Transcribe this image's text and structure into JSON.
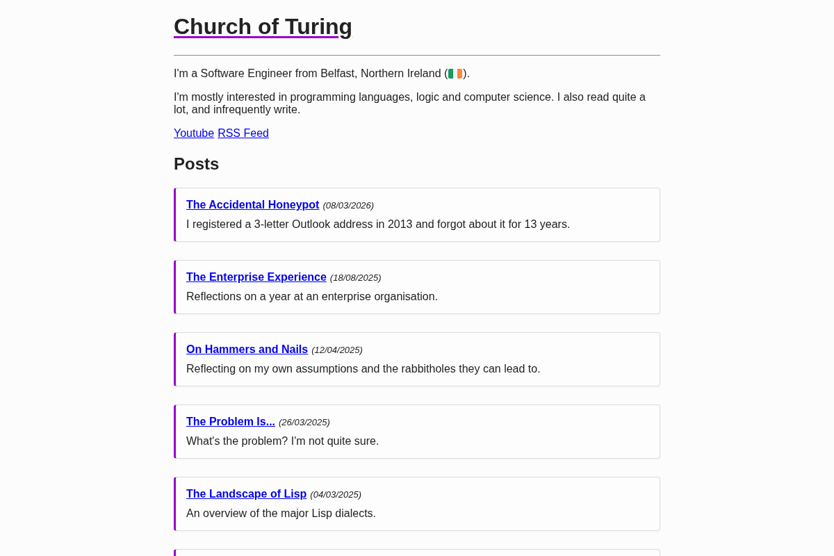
{
  "site_title": "Church of Turing",
  "intro": {
    "text_before_flag": "I'm a Software Engineer from Belfast, Northern Ireland (",
    "text_after_flag": ")."
  },
  "about": "I'm mostly interested in programming languages, logic and computer science. I also read quite a lot, and infrequently write.",
  "links": [
    "Youtube",
    "RSS Feed"
  ],
  "posts_heading": "Posts",
  "posts": [
    {
      "title": "The Accidental Honeypot",
      "date": "(08/03/2026)",
      "summary": "I registered a 3-letter Outlook address in 2013 and forgot about it for 13 years."
    },
    {
      "title": "The Enterprise Experience",
      "date": "(18/08/2025)",
      "summary": "Reflections on a year at an enterprise organisation."
    },
    {
      "title": "On Hammers and Nails",
      "date": "(12/04/2025)",
      "summary": "Reflecting on my own assumptions and the rabbitholes they can lead to."
    },
    {
      "title": "The Problem Is...",
      "date": "(26/03/2025)",
      "summary": "What's the problem? I'm not quite sure."
    },
    {
      "title": "The Landscape of Lisp",
      "date": "(04/03/2025)",
      "summary": "An overview of the major Lisp dialects."
    }
  ]
}
